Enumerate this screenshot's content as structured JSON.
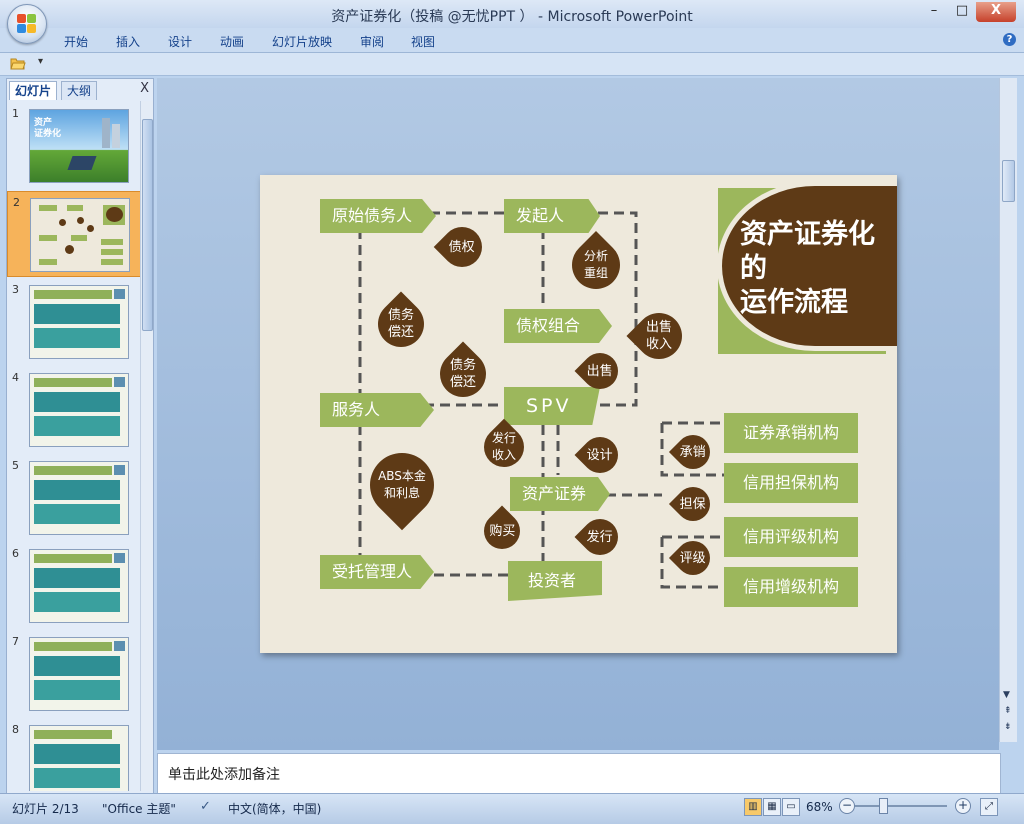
{
  "window": {
    "title": "资产证券化（投稿 @无忧PPT ） - Microsoft PowerPoint",
    "minimize": "–",
    "maximize": "□",
    "close": "X"
  },
  "ribbon": {
    "tabs": [
      "开始",
      "插入",
      "设计",
      "动画",
      "幻灯片放映",
      "审阅",
      "视图"
    ],
    "help": "?"
  },
  "qat": {
    "open_icon": "folder-open-icon",
    "more": "▾"
  },
  "slides_panel": {
    "tabs": [
      "幻灯片",
      "大纲"
    ],
    "close": "X",
    "numbers": [
      "1",
      "2",
      "3",
      "4",
      "5",
      "6",
      "7",
      "8"
    ],
    "selected_index": 2,
    "thumb1_text": "资产\n证券化"
  },
  "slide": {
    "title_lines": [
      "资产证券化",
      "的",
      "运作流程"
    ],
    "boxes": {
      "original_debtor": "原始债务人",
      "sponsor": "发起人",
      "debt_pool": "债权组合",
      "servicer": "服务人",
      "spv": "SPV",
      "asset_securities": "资产证券",
      "trustee": "受托管理人",
      "investors": "投资者",
      "underwriter": "证券承销机构",
      "guarantor": "信用担保机构",
      "rating": "信用评级机构",
      "enhancement": "信用增级机构"
    },
    "drops": {
      "claim": "债权",
      "analyze": "分析重组",
      "repay1": "债务偿还",
      "sell1": "出售收入",
      "repay2": "债务偿还",
      "sell2": "出售",
      "issue_income": "发行收入",
      "design": "设计",
      "abs_principal": "ABS本金和利息",
      "underwrite": "承销",
      "guarantee": "担保",
      "buy": "购买",
      "issue": "发行",
      "rate": "评级"
    }
  },
  "notes": {
    "placeholder": "单击此处添加备注"
  },
  "status": {
    "slide_counter": "幻灯片 2/13",
    "theme": "\"Office 主题\"",
    "language": "中文(简体，中国)",
    "zoom": "68%",
    "zoom_level": 0.68
  },
  "colors": {
    "green": "#9cb75c",
    "brown": "#5e3a16",
    "slide_bg": "#eee9dc"
  }
}
